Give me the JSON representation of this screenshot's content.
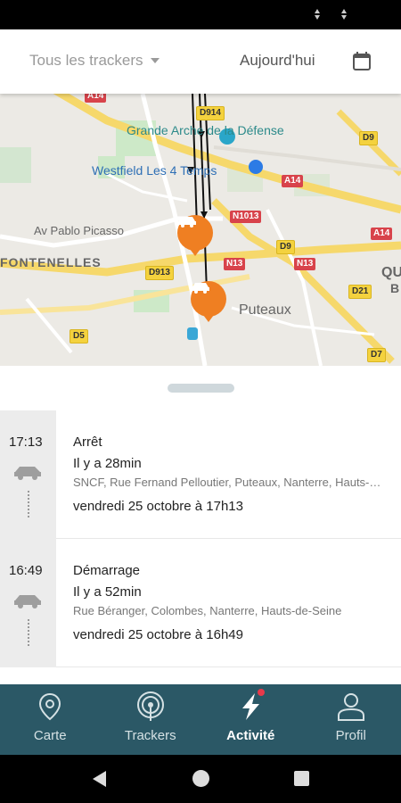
{
  "header": {
    "tracker_filter": "Tous les trackers",
    "date_filter": "Aujourd'hui"
  },
  "map": {
    "places": [
      "Grande Arche de la Défense",
      "Westfield Les 4 Temps",
      "Av Pablo Picasso",
      "FONTENELLES",
      "Puteaux",
      "QU",
      "B"
    ],
    "road_tags": [
      "A14",
      "D914",
      "D9",
      "A14",
      "N1013",
      "A14",
      "D9",
      "N13",
      "N13",
      "D913",
      "D21",
      "D5",
      "D7"
    ]
  },
  "timeline": {
    "events": [
      {
        "time": "17:13",
        "title": "Arrêt",
        "ago": "Il y a 28min",
        "address": "SNCF, Rue Fernand Pelloutier, Puteaux, Nanterre, Hauts-de-Seine",
        "date": "vendredi 25 octobre à 17h13"
      },
      {
        "time": "16:49",
        "title": "Démarrage",
        "ago": "Il y a 52min",
        "address": "Rue Béranger, Colombes, Nanterre, Hauts-de-Seine",
        "date": "vendredi 25 octobre à 16h49"
      }
    ]
  },
  "nav": {
    "items": [
      {
        "label": "Carte",
        "icon": "map-pin-icon"
      },
      {
        "label": "Trackers",
        "icon": "signal-icon"
      },
      {
        "label": "Activité",
        "icon": "bolt-icon",
        "active": true
      },
      {
        "label": "Profil",
        "icon": "user-icon"
      }
    ]
  },
  "colors": {
    "accent": "#ef7f22",
    "nav_bg": "#2b5866",
    "badge": "#e8394a"
  }
}
